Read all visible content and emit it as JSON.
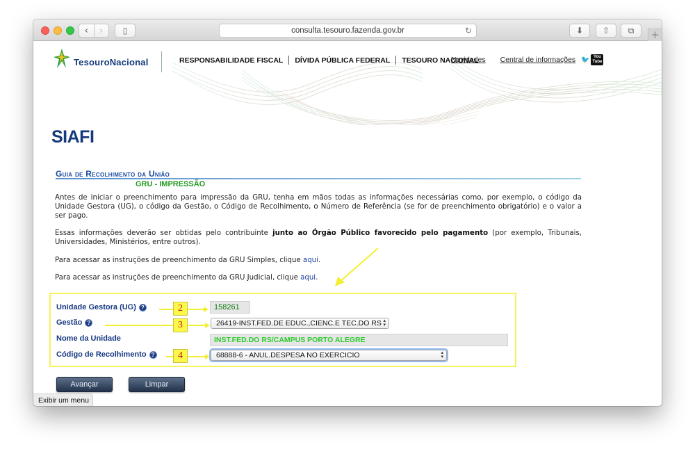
{
  "browser": {
    "url": "consulta.tesouro.fazenda.gov.br",
    "reload_glyph": "↻",
    "back_glyph": "‹",
    "forward_glyph": "›",
    "sidebar_glyph": "▯",
    "download_glyph": "⬇",
    "share_glyph": "⇧",
    "tabs_glyph": "⧉",
    "newtab_glyph": "+"
  },
  "header": {
    "logo_text": "TesouroNacional",
    "nav": [
      "RESPONSABILIDADE FISCAL",
      "DÍVIDA PÚBLICA FEDERAL",
      "TESOURO NACIONAL"
    ],
    "links": [
      "Novidades",
      "Central de informações"
    ],
    "social_glyph": "🐦",
    "youtube_line1": "You",
    "youtube_line2": "Tube"
  },
  "page": {
    "system_title": "SIAFI",
    "section_title": "Guia de Recolhimento da União",
    "section_subtitle": "GRU - IMPRESSÃO",
    "para1": "Antes de iniciar o preenchimento para impressão da GRU, tenha em mãos todas as informações necessárias como, por exemplo, o código da Unidade Gestora (UG), o código da Gestão, o Código de Recolhimento, o Número de Referência (se for de preenchimento obrigatório) e o valor a ser pago.",
    "para2_before": "Essas informações deverão ser obtidas pelo contribuinte ",
    "para2_bold": "junto ao Órgão Público favorecido pelo pagamento",
    "para2_after": " (por exemplo, Tribunais, Universidades, Ministérios, entre outros).",
    "para3_text": "Para acessar as instruções de preenchimento da GRU Simples, clique ",
    "para4_text": "Para acessar as instruções de preenchimento da GRU Judicial, clique ",
    "link_text": "aqui",
    "period": "."
  },
  "form": {
    "ug_label": "Unidade Gestora (UG)",
    "ug_value": "158261",
    "gestao_label": "Gestão",
    "gestao_value": "26419-INST.FED.DE EDUC.,CIENC.E TEC.DO RS",
    "nome_label": "Nome da Unidade",
    "nome_value": "INST.FED.DO RS/CAMPUS PORTO ALEGRE",
    "codigo_label": "Código de Recolhimento",
    "codigo_value": "68888-6 - ANUL.DESPESA NO EXERCICIO",
    "help_glyph": "?",
    "badges": [
      "2",
      "3",
      "4"
    ]
  },
  "buttons": {
    "advance": "Avançar",
    "clear": "Limpar"
  },
  "status": {
    "tooltip": "Exibir um menu"
  }
}
